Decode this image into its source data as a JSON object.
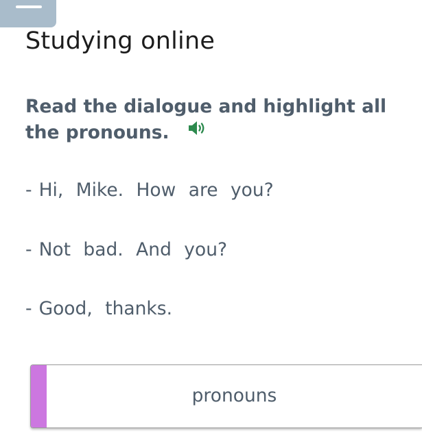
{
  "header": {
    "title": "Studying online"
  },
  "task": {
    "instruction": "Read the dialogue and highlight all the pronouns.",
    "audio_icon": "speaker-volume-icon",
    "audio_color": "#2d8a4e"
  },
  "dialogue": [
    {
      "dash": "-",
      "text": "Hi, Mike. How are you?"
    },
    {
      "dash": "-",
      "text": "Not bad. And you?"
    },
    {
      "dash": "-",
      "text": "Good, thanks."
    }
  ],
  "answer": {
    "label": "pronouns",
    "accent_color": "#cc77e0"
  },
  "menu": {
    "icon": "menu-handle-icon",
    "color": "#a9bccb"
  }
}
